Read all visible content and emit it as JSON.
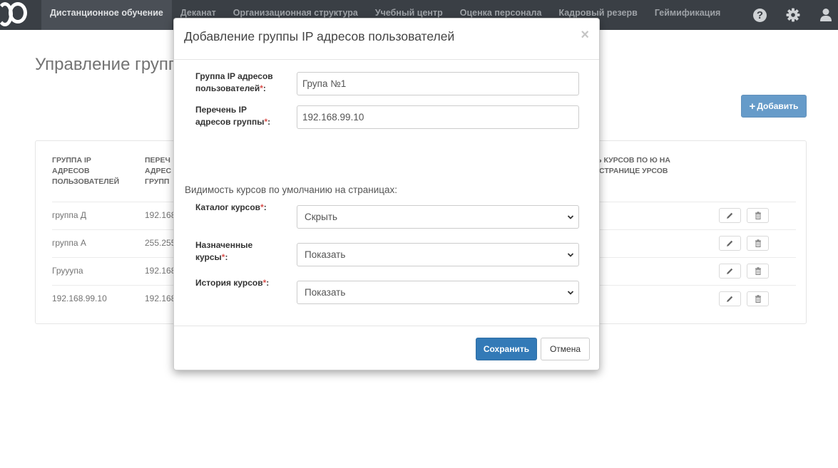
{
  "nav": {
    "items": [
      {
        "label": "Дистанционное обучение",
        "active": true
      },
      {
        "label": "Деканат"
      },
      {
        "label": "Организационная структура"
      },
      {
        "label": "Учебный центр"
      },
      {
        "label": "Оценка персонала"
      },
      {
        "label": "Кадровый резерв"
      },
      {
        "label": "Геймификация"
      }
    ],
    "help_glyph": "?"
  },
  "page": {
    "title": "Управление групп",
    "add_label": "Добавить",
    "add_glyph": "+",
    "table": {
      "headers": {
        "group": "ГРУППА IP АДРЕСОВ ПОЛЬЗОВАТЕЛЕЙ",
        "list": "ПЕРЕЧ АДРЕС ГРУПП",
        "visibility": "Ь КУРСОВ ПО Ю НА СТРАНИЦЕ УРСОВ"
      },
      "rows": [
        {
          "group": "группа Д",
          "list": "192.168"
        },
        {
          "group": "группа А",
          "list": "255.255"
        },
        {
          "group": "Грууупа",
          "list": "192.168"
        },
        {
          "group": "192.168.99.10",
          "list": "192.168"
        }
      ]
    }
  },
  "modal": {
    "title": "Добавление группы IP адресов пользователей",
    "close_glyph": "×",
    "required_mark": "*",
    "group_label": "Группа IP адресов пользователей",
    "group_value": "Група №1",
    "list_label": "Перечень IP адресов группы",
    "list_value": "192.168.99.10",
    "visibility_caption": "Видимость курсов по умолчанию на страницах:",
    "catalog_label": "Каталог курсов",
    "catalog_value": "Скрыть",
    "assigned_label": "Назначенные курсы",
    "assigned_value": "Показать",
    "history_label": "История курсов",
    "history_value": "Показать",
    "colon": ":",
    "save_label": "Сохранить",
    "cancel_label": "Отмена"
  },
  "colors": {
    "navbar": "#3a3f45",
    "primary": "#337ab7",
    "required": "#d9534f"
  },
  "icons": [
    "logo-mark",
    "help-icon",
    "gear-icon",
    "user-icon",
    "plus-icon",
    "pencil-icon",
    "trash-icon",
    "chevron-down-icon",
    "close-icon"
  ]
}
